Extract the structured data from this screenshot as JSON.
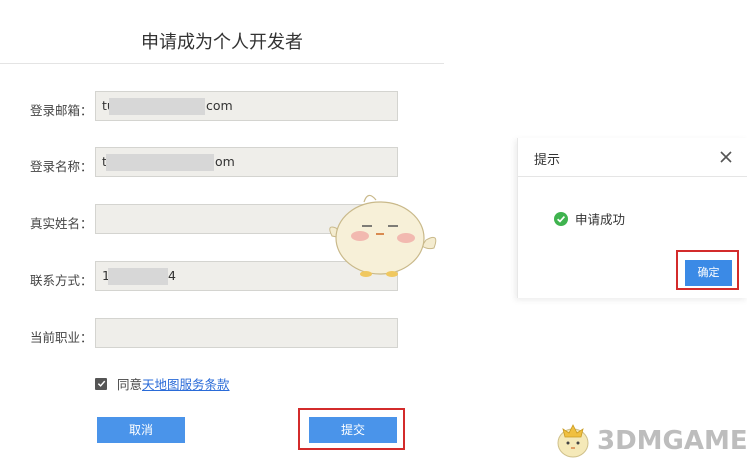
{
  "form": {
    "title": "申请成为个人开发者",
    "fields": [
      {
        "label": "登录邮箱：",
        "value_start": "tu",
        "value_end": "com"
      },
      {
        "label": "登录名称：",
        "value_start": "t",
        "value_end": "om"
      },
      {
        "label": "真实姓名：",
        "value_start": "",
        "value_end": ""
      },
      {
        "label": "联系方式：",
        "value_start": "1",
        "value_end": "4"
      },
      {
        "label": "当前职业：",
        "value_start": "",
        "value_end": ""
      }
    ],
    "agree_text": "同意",
    "terms_link": "天地图服务条款",
    "cancel_label": "取消",
    "submit_label": "提交"
  },
  "dialog": {
    "title": "提示",
    "message": "申请成功",
    "confirm_label": "确定"
  },
  "watermark": {
    "text": "3DMGAME"
  },
  "colors": {
    "primary_button": "#4a94ea",
    "highlight_box": "#d32b2b",
    "success": "#3fb34f",
    "input_bg": "#efeeea"
  }
}
